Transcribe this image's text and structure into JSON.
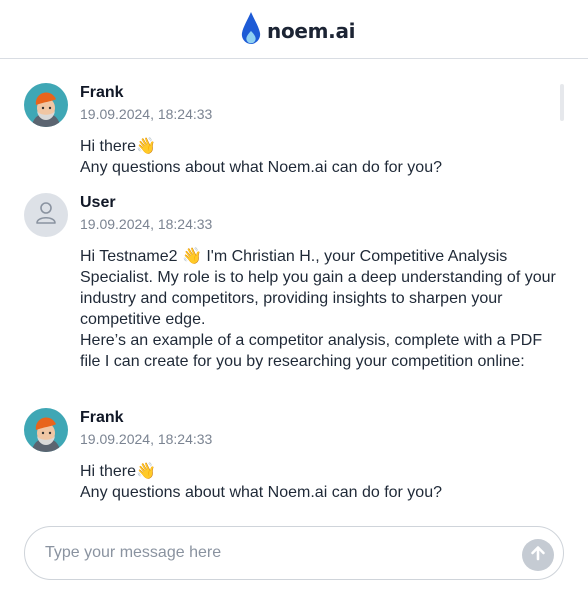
{
  "header": {
    "logo_text": "noem.ai",
    "logo_icon": "flame-drop-icon"
  },
  "messages": [
    {
      "author": "Frank",
      "timestamp": "19.09.2024, 18:24:33",
      "avatar": "frank-avatar",
      "lines": [
        "Hi there👋",
        "Any questions about what Noem.ai can do for you?"
      ]
    },
    {
      "author": "User",
      "timestamp": "19.09.2024, 18:24:33",
      "avatar": "user-icon",
      "lines": [
        "Hi Testname2 👋 I'm Christian H., your Competitive Analysis Specialist. My role is to help you gain a deep understanding of your industry and competitors, providing insights to sharpen your competitive edge.",
        "Here’s an example of a competitor analysis, complete with a PDF file I can create for you by researching your competition online:"
      ]
    },
    {
      "author": "Frank",
      "timestamp": "19.09.2024, 18:24:33",
      "avatar": "frank-avatar",
      "lines": [
        "Hi there👋",
        "Any questions about what Noem.ai can do for you?"
      ]
    }
  ],
  "composer": {
    "placeholder": "Type your message here",
    "value": "",
    "send_icon": "arrow-up-icon"
  },
  "colors": {
    "brand_blue": "#2563eb",
    "send_button": "#c5cbd3",
    "avatar_bg": "#3fa7b5",
    "hat_orange": "#e8641c"
  }
}
